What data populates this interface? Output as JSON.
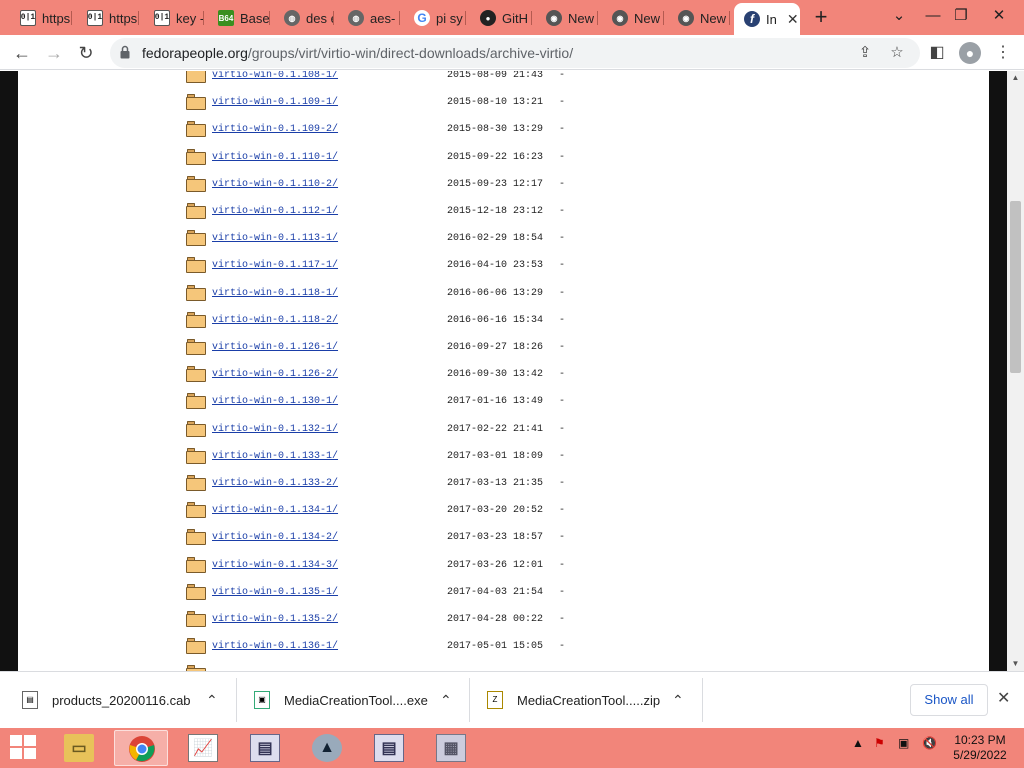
{
  "browser": {
    "tabs": [
      {
        "title": "https",
        "favicon": "binary-icon",
        "active": false
      },
      {
        "title": "https",
        "favicon": "binary-icon",
        "active": false
      },
      {
        "title": "key -",
        "favicon": "binary-icon",
        "active": false
      },
      {
        "title": "Base",
        "favicon": "b64-icon",
        "active": false
      },
      {
        "title": "des e",
        "favicon": "globe-icon",
        "active": false
      },
      {
        "title": "aes-",
        "favicon": "globe-icon",
        "active": false
      },
      {
        "title": "pi sy",
        "favicon": "google-icon",
        "active": false
      },
      {
        "title": "GitH",
        "favicon": "github-icon",
        "active": false
      },
      {
        "title": "New",
        "favicon": "chrome-icon",
        "active": false
      },
      {
        "title": "New",
        "favicon": "chrome-icon",
        "active": false
      },
      {
        "title": "New",
        "favicon": "chrome-icon",
        "active": false
      },
      {
        "title": "In",
        "favicon": "fedora-icon",
        "active": true
      }
    ],
    "url_host": "fedorapeople.org",
    "url_path": "/groups/virt/virtio-win/direct-downloads/archive-virtio/"
  },
  "listing": {
    "rows": [
      {
        "name": "virtio-win-0.1.108-1/",
        "date": "2015-08-09 21:43",
        "size": "-"
      },
      {
        "name": "virtio-win-0.1.109-1/",
        "date": "2015-08-10 13:21",
        "size": "-"
      },
      {
        "name": "virtio-win-0.1.109-2/",
        "date": "2015-08-30 13:29",
        "size": "-"
      },
      {
        "name": "virtio-win-0.1.110-1/",
        "date": "2015-09-22 16:23",
        "size": "-"
      },
      {
        "name": "virtio-win-0.1.110-2/",
        "date": "2015-09-23 12:17",
        "size": "-"
      },
      {
        "name": "virtio-win-0.1.112-1/",
        "date": "2015-12-18 23:12",
        "size": "-"
      },
      {
        "name": "virtio-win-0.1.113-1/",
        "date": "2016-02-29 18:54",
        "size": "-"
      },
      {
        "name": "virtio-win-0.1.117-1/",
        "date": "2016-04-10 23:53",
        "size": "-"
      },
      {
        "name": "virtio-win-0.1.118-1/",
        "date": "2016-06-06 13:29",
        "size": "-"
      },
      {
        "name": "virtio-win-0.1.118-2/",
        "date": "2016-06-16 15:34",
        "size": "-"
      },
      {
        "name": "virtio-win-0.1.126-1/",
        "date": "2016-09-27 18:26",
        "size": "-"
      },
      {
        "name": "virtio-win-0.1.126-2/",
        "date": "2016-09-30 13:42",
        "size": "-"
      },
      {
        "name": "virtio-win-0.1.130-1/",
        "date": "2017-01-16 13:49",
        "size": "-"
      },
      {
        "name": "virtio-win-0.1.132-1/",
        "date": "2017-02-22 21:41",
        "size": "-"
      },
      {
        "name": "virtio-win-0.1.133-1/",
        "date": "2017-03-01 18:09",
        "size": "-"
      },
      {
        "name": "virtio-win-0.1.133-2/",
        "date": "2017-03-13 21:35",
        "size": "-"
      },
      {
        "name": "virtio-win-0.1.134-1/",
        "date": "2017-03-20 20:52",
        "size": "-"
      },
      {
        "name": "virtio-win-0.1.134-2/",
        "date": "2017-03-23 18:57",
        "size": "-"
      },
      {
        "name": "virtio-win-0.1.134-3/",
        "date": "2017-03-26 12:01",
        "size": "-"
      },
      {
        "name": "virtio-win-0.1.135-1/",
        "date": "2017-04-03 21:54",
        "size": "-"
      },
      {
        "name": "virtio-win-0.1.135-2/",
        "date": "2017-04-28 00:22",
        "size": "-"
      },
      {
        "name": "virtio-win-0.1.136-1/",
        "date": "2017-05-01 15:05",
        "size": "-"
      }
    ]
  },
  "downloads": {
    "items": [
      {
        "name": "products_20200116.cab",
        "icon": "cab-file-icon"
      },
      {
        "name": "MediaCreationTool....exe",
        "icon": "exe-file-icon"
      },
      {
        "name": "MediaCreationTool.....zip",
        "icon": "zip-file-icon"
      }
    ],
    "show_all_label": "Show all"
  },
  "taskbar": {
    "apps": [
      "file-explorer-icon",
      "chrome-icon",
      "notepad-icon",
      "window-app-icon",
      "steam-icon",
      "window-app-icon",
      "photo-app-icon"
    ],
    "time": "10:23 PM",
    "date": "5/29/2022"
  }
}
